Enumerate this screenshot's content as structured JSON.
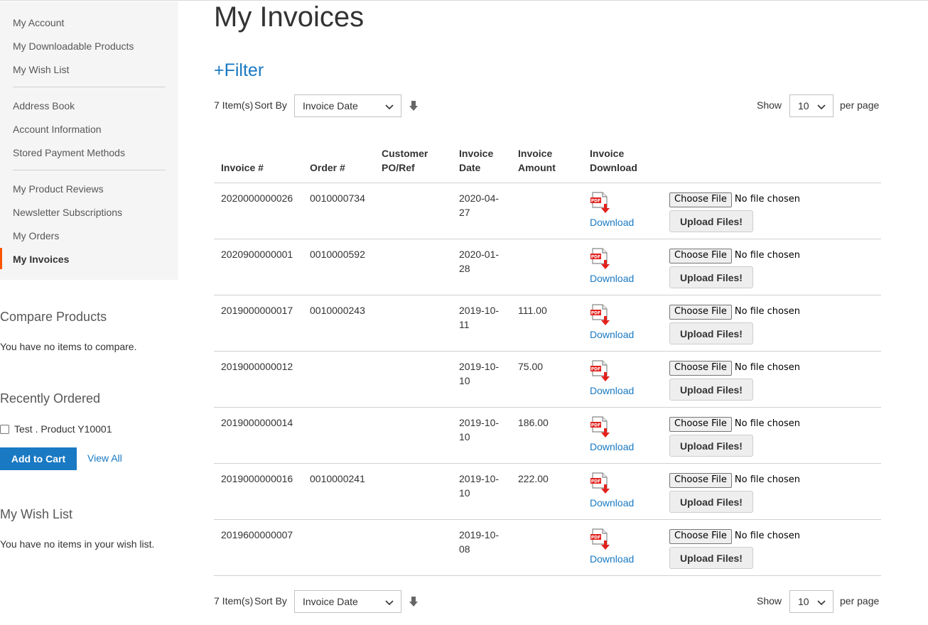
{
  "sidebar": {
    "nav_items": [
      {
        "label": "My Account"
      },
      {
        "label": "My Downloadable Products"
      },
      {
        "label": "My Wish List"
      },
      {
        "label": "Address Book"
      },
      {
        "label": "Account Information"
      },
      {
        "label": "Stored Payment Methods"
      },
      {
        "label": "My Product Reviews"
      },
      {
        "label": "Newsletter Subscriptions"
      },
      {
        "label": "My Orders"
      },
      {
        "label": "My Invoices"
      }
    ],
    "active_item": "My Invoices",
    "compare": {
      "title": "Compare Products",
      "text": "You have no items to compare."
    },
    "recently_ordered": {
      "title": "Recently Ordered",
      "item_label": "Test . Product Y10001",
      "add_to_cart": "Add to Cart",
      "view_all": "View All"
    },
    "wishlist": {
      "title": "My Wish List",
      "text": "You have no items in your wish list."
    }
  },
  "main": {
    "title": "My Invoices",
    "filter_label": "+Filter",
    "toolbar": {
      "count": "7 Item(s)",
      "sort_label": "Sort By",
      "sort_value": "Invoice Date",
      "show_label": "Show",
      "limit_value": "10",
      "per_page_label": "per page"
    },
    "table": {
      "headers": {
        "invoice": "Invoice #",
        "order": "Order #",
        "po": "Customer PO/Ref",
        "date": "Invoice Date",
        "amount": "Invoice Amount",
        "download": "Invoice Download"
      },
      "download_label": "Download",
      "choose_file_label": "Choose File",
      "no_file_label": "No file chosen",
      "upload_label": "Upload Files!",
      "rows": [
        {
          "invoice": "2020000000026",
          "order": "0010000734",
          "po": "",
          "date": "2020-04-27",
          "amount": ""
        },
        {
          "invoice": "2020900000001",
          "order": "0010000592",
          "po": "",
          "date": "2020-01-28",
          "amount": ""
        },
        {
          "invoice": "2019000000017",
          "order": "0010000243",
          "po": "",
          "date": "2019-10-11",
          "amount": "111.00"
        },
        {
          "invoice": "2019000000012",
          "order": "",
          "po": "",
          "date": "2019-10-10",
          "amount": "75.00"
        },
        {
          "invoice": "2019000000014",
          "order": "",
          "po": "",
          "date": "2019-10-10",
          "amount": "186.00"
        },
        {
          "invoice": "2019000000016",
          "order": "0010000241",
          "po": "",
          "date": "2019-10-10",
          "amount": "222.00"
        },
        {
          "invoice": "2019600000007",
          "order": "",
          "po": "",
          "date": "2019-10-08",
          "amount": ""
        }
      ]
    }
  },
  "icons": {
    "pdf": "pdf-download-icon",
    "sort_direction": "arrow-down-icon",
    "select_chevron": "chevron-down-icon"
  },
  "colors": {
    "link": "#1979c3",
    "accent": "#ff5501",
    "button_primary": "#1979c3",
    "pdf_red": "#e3201b"
  }
}
